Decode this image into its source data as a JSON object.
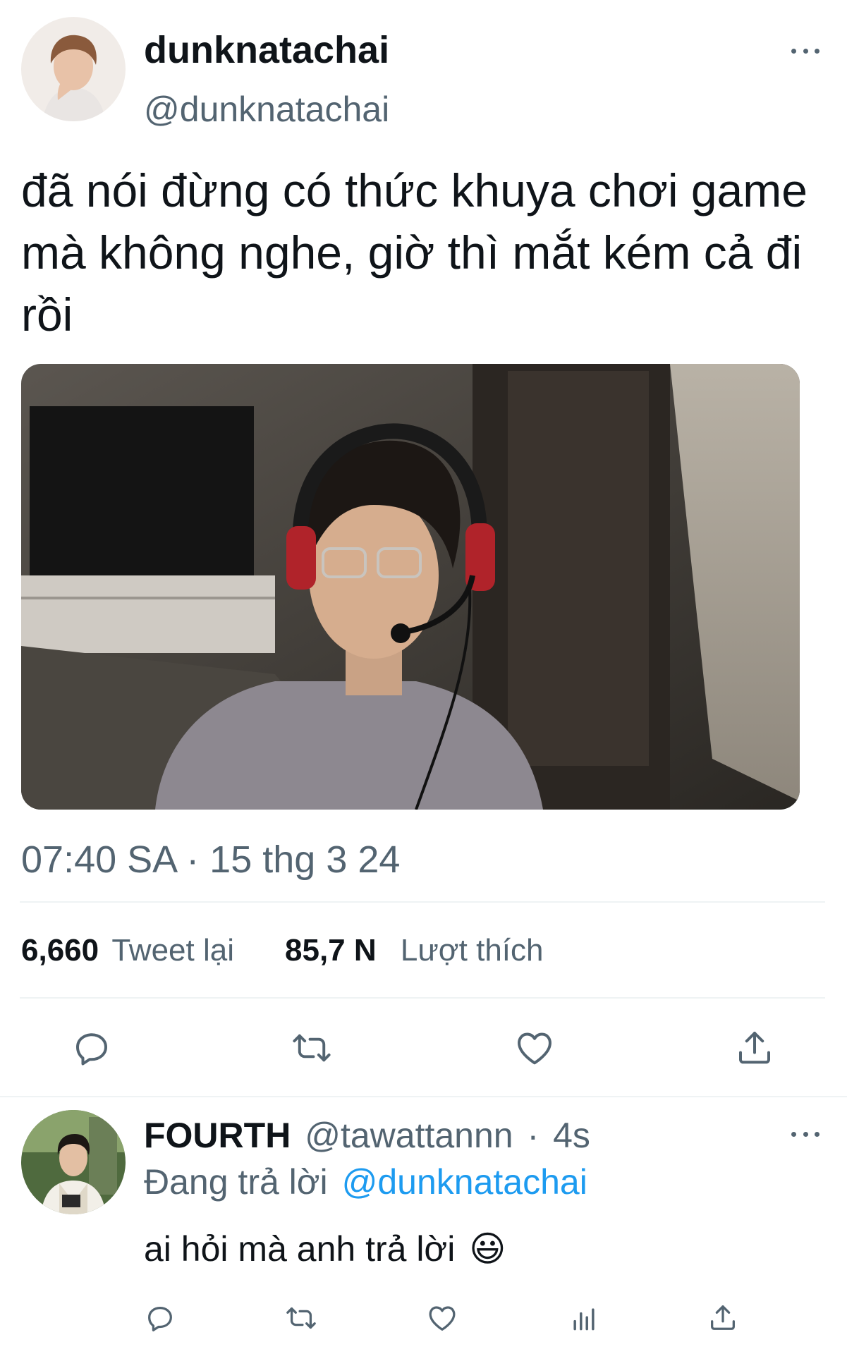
{
  "tweet": {
    "display_name": "dunknatachai",
    "handle": "@dunknatachai",
    "text": "đã nói đừng có thức khuya chơi game mà không nghe, giờ thì mắt kém cả đi rồi",
    "timestamp": "07:40 SA · 15 thg 3 24",
    "stats": {
      "retweets_count": "6,660",
      "retweets_label": "Tweet lại",
      "likes_count": "85,7 N",
      "likes_label": "Lượt thích"
    },
    "actions": [
      "reply-icon",
      "retweet-icon",
      "like-icon",
      "share-icon"
    ]
  },
  "reply": {
    "display_name": "FOURTH",
    "handle": "@tawattannn",
    "separator": "·",
    "age": "4s",
    "replying_to_label": "Đang trả lời",
    "replying_to_handle": "@dunknatachai",
    "text": "ai hỏi mà anh trả lời",
    "emoji": "😃",
    "actions": [
      "reply-icon",
      "retweet-icon",
      "like-icon",
      "analytics-icon",
      "share-icon"
    ]
  },
  "colors": {
    "text": "#0f1419",
    "secondary": "#536471",
    "link": "#1d9bf0",
    "divider": "#eff3f4"
  }
}
